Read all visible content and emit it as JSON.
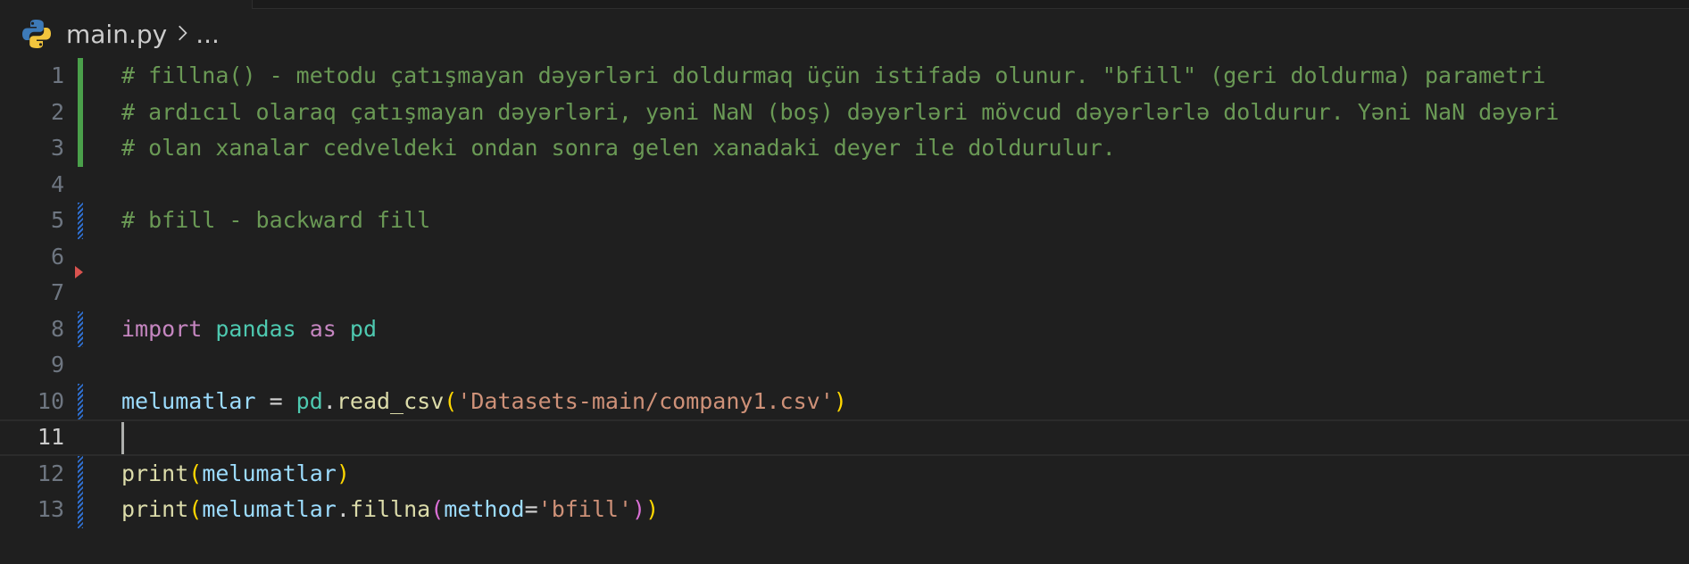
{
  "breadcrumb": {
    "file": "main.py",
    "separator": ">",
    "more": "..."
  },
  "icons": {
    "file_icon": "python-icon",
    "chevron": "chevron-right-icon"
  },
  "colors": {
    "background": "#1f1f1f",
    "comment": "#6a9955",
    "keyword": "#c586c0",
    "module": "#4ec9b0",
    "variable": "#9cdcfe",
    "function": "#dcdcaa",
    "string": "#ce9178",
    "bracket_gold": "#ffd700",
    "bracket_purple": "#da70d6",
    "gutter_added": "#4aa04a",
    "gutter_modified": "#2f6fcf"
  },
  "editor": {
    "active_line": 11,
    "lines": [
      {
        "n": "1",
        "comment": "# fillna() - metodu çatışmayan dəyərləri doldurmaq üçün istifadə olunur. \"bfill\" (geri doldurma) parametri"
      },
      {
        "n": "2",
        "comment": "# ardıcıl olaraq çatışmayan dəyərləri, yəni NaN (boş) dəyərləri mövcud dəyərlərlə doldurur. Yəni NaN dəyəri"
      },
      {
        "n": "3",
        "comment": "# olan xanalar cedveldeki ondan sonra gelen xanadaki deyer ile doldurulur."
      },
      {
        "n": "4"
      },
      {
        "n": "5",
        "comment": "# bfill - backward fill"
      },
      {
        "n": "6"
      },
      {
        "n": "7"
      },
      {
        "n": "8",
        "kw_import": "import",
        "module": "pandas",
        "kw_as": "as",
        "alias": "pd"
      },
      {
        "n": "9"
      },
      {
        "n": "10",
        "var": "melumatlar",
        "assign": " = ",
        "mod": "pd",
        "dot": ".",
        "fn": "read_csv",
        "open": "(",
        "str": "'Datasets-main/company1.csv'",
        "close": ")"
      },
      {
        "n": "11"
      },
      {
        "n": "12",
        "fn": "print",
        "open": "(",
        "arg": "melumatlar",
        "close": ")"
      },
      {
        "n": "13",
        "fn": "print",
        "open": "(",
        "obj": "melumatlar",
        "dot": ".",
        "method": "fillna",
        "open2": "(",
        "kwarg": "method",
        "eq": "=",
        "str": "'bfill'",
        "close2": ")",
        "close": ")"
      }
    ]
  }
}
